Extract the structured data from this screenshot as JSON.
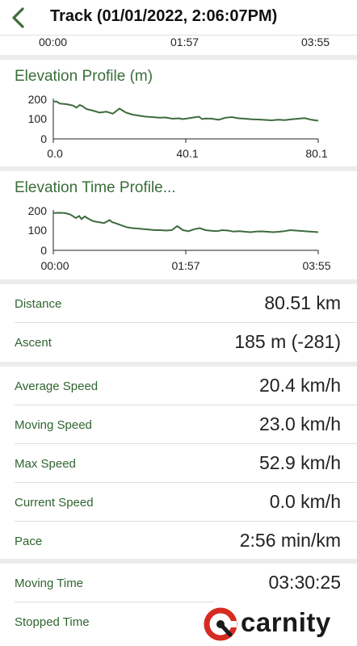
{
  "header": {
    "title": "Track (01/01/2022, 2:06:07PM)"
  },
  "previous_axis": {
    "ticks": [
      "00:00",
      "01:57",
      "03:55"
    ]
  },
  "elevation_profile": {
    "title": "Elevation Profile (m)",
    "y_ticks": [
      "200",
      "100",
      "0"
    ],
    "x_ticks": [
      "0.0",
      "40.1",
      "80.1"
    ]
  },
  "elevation_time_profile": {
    "title": "Elevation Time Profile...",
    "y_ticks": [
      "200",
      "100",
      "0"
    ],
    "x_ticks": [
      "00:00",
      "01:57",
      "03:55"
    ]
  },
  "stats": {
    "distance": {
      "label": "Distance",
      "value": "80.51 km"
    },
    "ascent": {
      "label": "Ascent",
      "value": "185 m (-281)"
    },
    "average_speed": {
      "label": "Average Speed",
      "value": "20.4 km/h"
    },
    "moving_speed": {
      "label": "Moving Speed",
      "value": "23.0 km/h"
    },
    "max_speed": {
      "label": "Max Speed",
      "value": "52.9 km/h"
    },
    "current_speed": {
      "label": "Current Speed",
      "value": "0.0 km/h"
    },
    "pace": {
      "label": "Pace",
      "value": "2:56 min/km"
    },
    "moving_time": {
      "label": "Moving Time",
      "value": "03:30:25"
    },
    "stopped_time": {
      "label": "Stopped Time",
      "value": ""
    }
  },
  "watermark": {
    "text": "carnity"
  },
  "colors": {
    "accent": "#3a6d3a",
    "line": "#3d6b3d",
    "brand_red": "#d62b20"
  },
  "chart_data": [
    {
      "type": "line",
      "title": "Elevation Profile (m)",
      "ylim": [
        0,
        200
      ],
      "xlim": [
        0,
        80.1
      ],
      "series": [
        {
          "x": [
            0,
            1,
            2,
            4,
            6,
            7,
            8,
            9,
            10,
            12,
            14,
            16,
            18,
            20,
            21,
            22,
            24,
            26,
            28,
            30,
            32,
            34,
            36,
            38,
            39,
            40,
            42,
            44,
            45,
            46,
            48,
            50,
            52,
            54,
            56,
            58,
            60,
            62,
            64,
            66,
            68,
            70,
            72,
            74,
            76,
            78,
            80.1
          ],
          "y": [
            185,
            185,
            175,
            172,
            165,
            155,
            168,
            160,
            148,
            140,
            130,
            135,
            125,
            150,
            140,
            130,
            120,
            115,
            110,
            108,
            105,
            106,
            100,
            102,
            98,
            100,
            105,
            110,
            98,
            101,
            100,
            95,
            105,
            108,
            102,
            100,
            97,
            96,
            94,
            92,
            95,
            93,
            97,
            100,
            103,
            95,
            90
          ]
        }
      ]
    },
    {
      "type": "line",
      "title": "Elevation Time Profile...",
      "ylim": [
        0,
        200
      ],
      "xlim": [
        "00:00",
        "03:55"
      ],
      "series": [
        {
          "x": [
            "00:00",
            "00:05",
            "00:10",
            "00:15",
            "00:20",
            "00:23",
            "00:25",
            "00:28",
            "00:30",
            "00:35",
            "00:40",
            "00:45",
            "00:50",
            "00:52",
            "00:55",
            "01:00",
            "01:05",
            "01:10",
            "01:15",
            "01:20",
            "01:25",
            "01:30",
            "01:35",
            "01:40",
            "01:45",
            "01:50",
            "01:55",
            "02:00",
            "02:05",
            "02:10",
            "02:15",
            "02:20",
            "02:25",
            "02:30",
            "02:35",
            "02:40",
            "02:45",
            "02:50",
            "02:55",
            "03:00",
            "03:05",
            "03:10",
            "03:15",
            "03:20",
            "03:25",
            "03:30",
            "03:35",
            "03:40",
            "03:45",
            "03:50",
            "03:55"
          ],
          "y": [
            185,
            186,
            185,
            178,
            160,
            170,
            155,
            168,
            160,
            145,
            140,
            135,
            150,
            140,
            135,
            125,
            115,
            110,
            108,
            105,
            103,
            100,
            100,
            98,
            100,
            120,
            100,
            95,
            105,
            110,
            100,
            97,
            95,
            100,
            98,
            93,
            95,
            92,
            90,
            93,
            94,
            92,
            90,
            92,
            95,
            100,
            98,
            96,
            94,
            92,
            90
          ]
        }
      ]
    }
  ]
}
